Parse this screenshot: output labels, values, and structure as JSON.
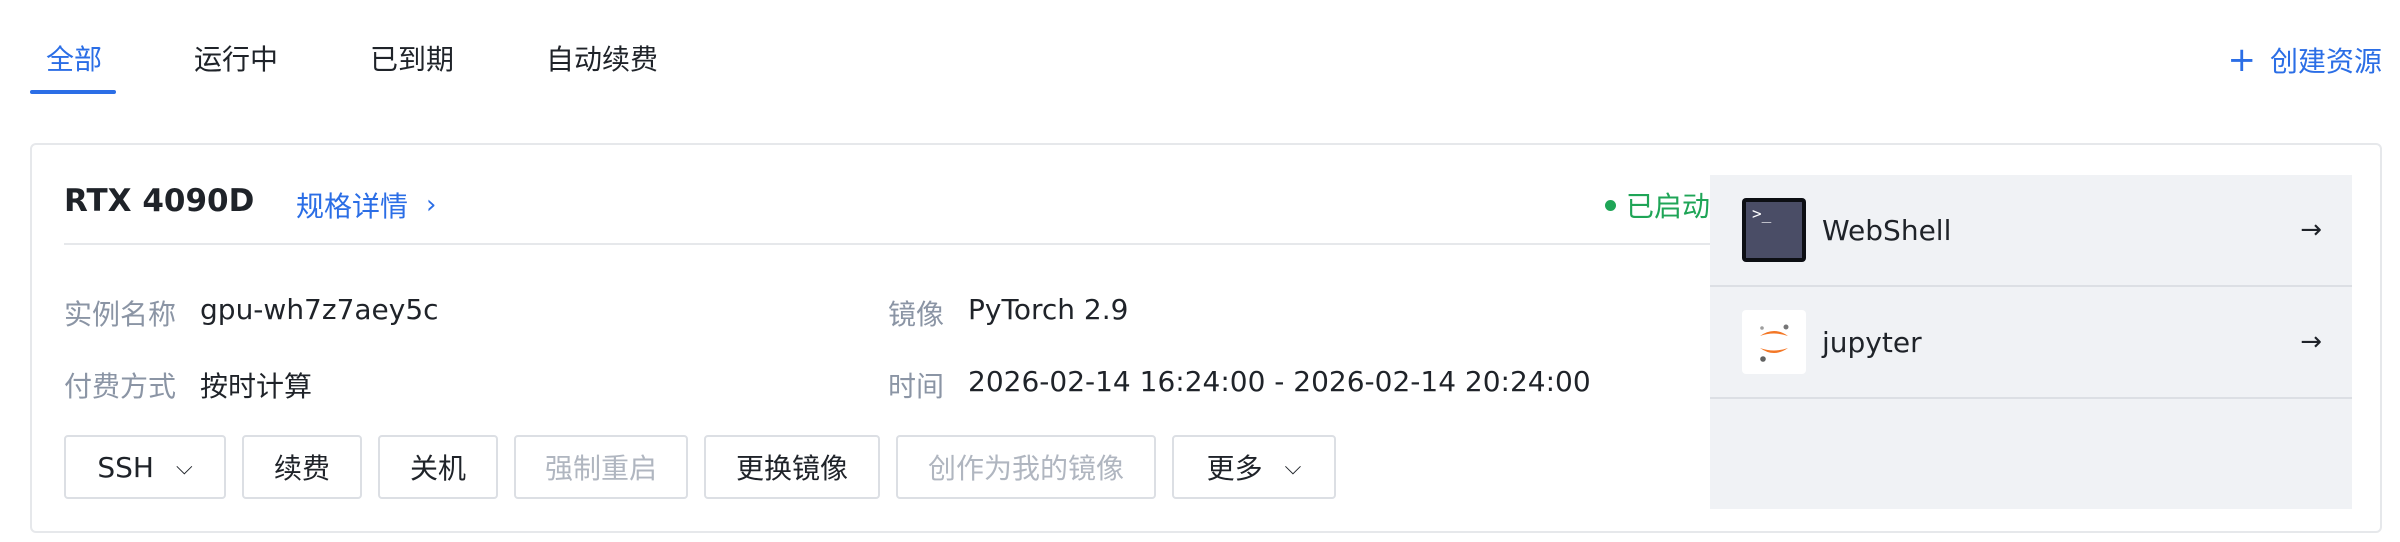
{
  "tabs": [
    {
      "label": "全部",
      "active": true
    },
    {
      "label": "运行中",
      "active": false
    },
    {
      "label": "已到期",
      "active": false
    },
    {
      "label": "自动续费",
      "active": false
    }
  ],
  "create_button": {
    "icon": "plus-icon",
    "label": "创建资源"
  },
  "instance": {
    "model": "RTX 4090D",
    "spec_link": "规格详情",
    "status": "已启动",
    "status_color": "#1fa557",
    "fields": {
      "name_label": "实例名称",
      "name_value": "gpu-wh7z7aey5c",
      "image_label": "镜像",
      "image_value": "PyTorch 2.9",
      "pay_label": "付费方式",
      "pay_value": "按时计算",
      "time_label": "时间",
      "time_value": "2026-02-14 16:24:00 - 2026-02-14 20:24:00"
    },
    "actions": {
      "ssh": "SSH",
      "renew": "续费",
      "shutdown": "关机",
      "force_restart": "强制重启",
      "change_image": "更换镜像",
      "create_my_image": "创作为我的镜像",
      "more": "更多"
    }
  },
  "side": {
    "items": [
      {
        "label": "WebShell",
        "icon": "terminal-icon"
      },
      {
        "label": "jupyter",
        "icon": "jupyter-icon"
      }
    ]
  },
  "colors": {
    "accent": "#2b6ee6",
    "disabled": "#b0b6c0",
    "muted": "#8b95a5"
  }
}
